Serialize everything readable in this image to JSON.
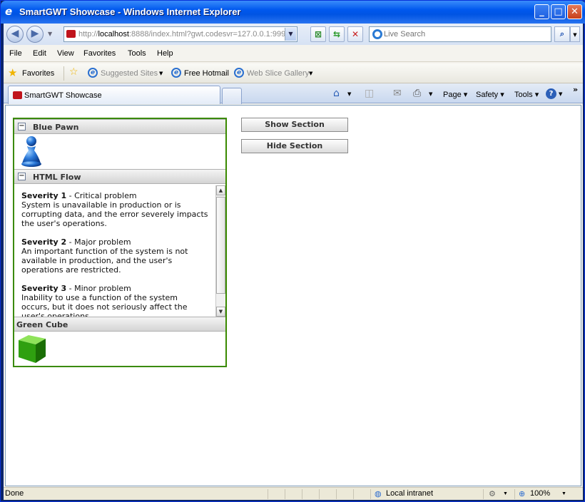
{
  "window": {
    "title": "SmartGWT Showcase - Windows Internet Explorer",
    "minimize": "_",
    "maximize": "□",
    "close": "✕"
  },
  "address_bar": {
    "url_prefix": "http://",
    "url_host": "localhost",
    "url_rest": ":8888/index.html?gwt.codesvr=127.0.0.1:999",
    "search_placeholder": "Live Search"
  },
  "menu": [
    "File",
    "Edit",
    "View",
    "Favorites",
    "Tools",
    "Help"
  ],
  "favorites_bar": {
    "favorites_label": "Favorites",
    "items": [
      "Suggested Sites",
      "Free Hotmail",
      "Web Slice Gallery"
    ]
  },
  "tab": {
    "title": "SmartGWT Showcase"
  },
  "command_bar": {
    "page": "Page",
    "safety": "Safety",
    "tools": "Tools"
  },
  "sections": {
    "blue_pawn": "Blue Pawn",
    "html_flow": "HTML Flow",
    "green_cube": "Green Cube",
    "toggle_symbol": "−"
  },
  "html_flow": {
    "items": [
      {
        "title": "Severity 1",
        "subtitle": " - Critical problem",
        "body": "System is unavailable in production or is corrupting data, and the error severely impacts the user's operations."
      },
      {
        "title": "Severity 2",
        "subtitle": " - Major problem",
        "body": "An important function of the system is not available in production, and the user's operations are restricted."
      },
      {
        "title": "Severity 3",
        "subtitle": " - Minor problem",
        "body": "Inability to use a function of the system occurs, but it does not seriously affect the user's operations."
      }
    ]
  },
  "buttons": {
    "show_section": "Show Section",
    "hide_section": "Hide Section"
  },
  "status_bar": {
    "status": "Done",
    "zone": "Local intranet",
    "zoom": "100%"
  }
}
